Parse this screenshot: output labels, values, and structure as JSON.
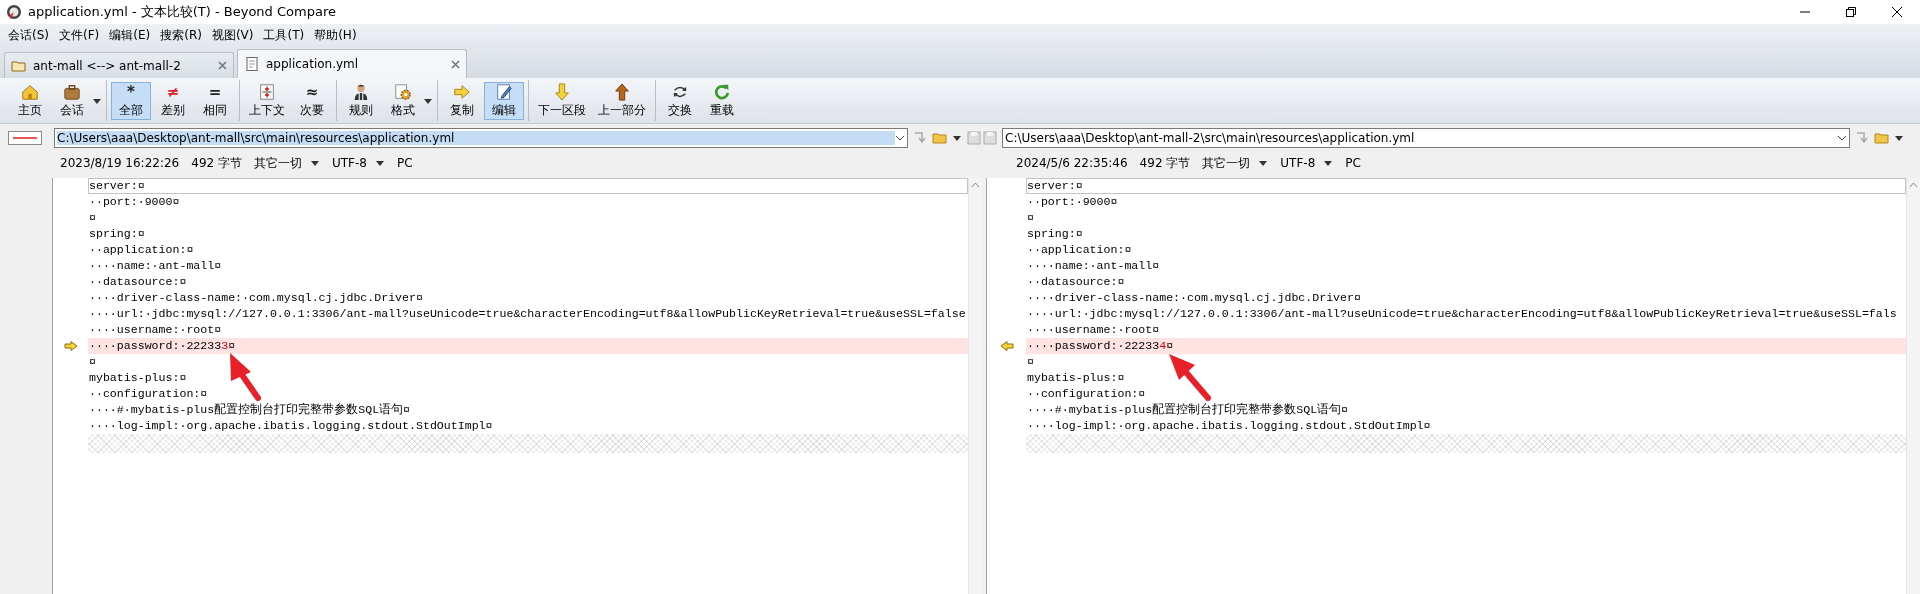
{
  "window": {
    "title": "application.yml - 文本比较(T) - Beyond Compare"
  },
  "menu": [
    "会话(S)",
    "文件(F)",
    "编辑(E)",
    "搜索(R)",
    "视图(V)",
    "工具(T)",
    "帮助(H)"
  ],
  "tabs": [
    {
      "label": "ant-mall <--> ant-mall-2",
      "selected": false
    },
    {
      "label": "application.yml",
      "selected": true
    }
  ],
  "toolbar": {
    "groups": [
      [
        {
          "label": "主页",
          "dropdown": false,
          "selected": false
        },
        {
          "label": "会话",
          "dropdown": true,
          "selected": false
        }
      ],
      [
        {
          "label": "全部",
          "glyph": "*",
          "color": "#202020",
          "dropdown": false,
          "selected": true
        },
        {
          "label": "差别",
          "glyph": "≠",
          "color": "#e02020",
          "dropdown": false,
          "selected": false
        },
        {
          "label": "相同",
          "glyph": "=",
          "color": "#202020",
          "dropdown": false,
          "selected": false
        }
      ],
      [
        {
          "label": "上下文",
          "dropdown": false,
          "selected": false
        },
        {
          "label": "次要",
          "glyph": "≈",
          "color": "#202020",
          "dropdown": false,
          "selected": false
        }
      ],
      [
        {
          "label": "规则",
          "dropdown": false,
          "selected": false
        },
        {
          "label": "格式",
          "dropdown": true,
          "selected": false
        }
      ],
      [
        {
          "label": "复制",
          "dropdown": false,
          "selected": false
        },
        {
          "label": "编辑",
          "dropdown": false,
          "selected": true
        }
      ],
      [
        {
          "label": "下一区段",
          "dropdown": false,
          "selected": false
        },
        {
          "label": "上一部分",
          "dropdown": false,
          "selected": false
        }
      ],
      [
        {
          "label": "交换",
          "dropdown": false,
          "selected": false
        },
        {
          "label": "重载",
          "dropdown": false,
          "selected": false
        }
      ]
    ]
  },
  "panes": [
    {
      "path": "C:\\Users\\aaa\\Desktop\\ant-mall\\src\\main\\resources\\application.yml",
      "focused": true,
      "date": "2023/8/19 16:22:26",
      "size": "492 字节",
      "filter": "其它一切",
      "encoding": "UTF-8",
      "line_ending": "PC",
      "lines": [
        {
          "text": "server:¤",
          "changed": false,
          "current": true
        },
        {
          "text": "··port:·9000¤",
          "changed": false,
          "current": false
        },
        {
          "text": "¤",
          "changed": false,
          "current": false
        },
        {
          "text": "spring:¤",
          "changed": false,
          "current": false
        },
        {
          "text": "··application:¤",
          "changed": false,
          "current": false
        },
        {
          "text": "····name:·ant-mall¤",
          "changed": false,
          "current": false
        },
        {
          "text": "··datasource:¤",
          "changed": false,
          "current": false
        },
        {
          "text": "····driver-class-name:·com.mysql.cj.jdbc.Driver¤",
          "changed": false,
          "current": false
        },
        {
          "text": "····url:·jdbc:mysql://127.0.0.1:3306/ant-mall?useUnicode=true&characterEncoding=utf8&allowPublicKeyRetrieval=true&useSSL=false",
          "changed": false,
          "current": false
        },
        {
          "text": "····username:·root¤",
          "changed": false,
          "current": false
        },
        {
          "text": "····password:·22233",
          "diff": "3",
          "tail": "¤",
          "changed": true,
          "current": false
        },
        {
          "text": "¤",
          "changed": false,
          "current": false
        },
        {
          "text": "mybatis-plus:¤",
          "changed": false,
          "current": false
        },
        {
          "text": "··configuration:¤",
          "changed": false,
          "current": false
        },
        {
          "text": "····#·mybatis-plus配置控制台打印完整带参数SQL语句¤",
          "changed": false,
          "current": false
        },
        {
          "text": "····log-impl:·org.apache.ibatis.logging.stdout.StdOutImpl¤",
          "changed": false,
          "current": false
        }
      ]
    },
    {
      "path": "C:\\Users\\aaa\\Desktop\\ant-mall-2\\src\\main\\resources\\application.yml",
      "focused": false,
      "date": "2024/5/6 22:35:46",
      "size": "492 字节",
      "filter": "其它一切",
      "encoding": "UTF-8",
      "line_ending": "PC",
      "lines": [
        {
          "text": "server:¤",
          "changed": false,
          "current": true
        },
        {
          "text": "··port:·9000¤",
          "changed": false,
          "current": false
        },
        {
          "text": "¤",
          "changed": false,
          "current": false
        },
        {
          "text": "spring:¤",
          "changed": false,
          "current": false
        },
        {
          "text": "··application:¤",
          "changed": false,
          "current": false
        },
        {
          "text": "····name:·ant-mall¤",
          "changed": false,
          "current": false
        },
        {
          "text": "··datasource:¤",
          "changed": false,
          "current": false
        },
        {
          "text": "····driver-class-name:·com.mysql.cj.jdbc.Driver¤",
          "changed": false,
          "current": false
        },
        {
          "text": "····url:·jdbc:mysql://127.0.0.1:3306/ant-mall?useUnicode=true&characterEncoding=utf8&allowPublicKeyRetrieval=true&useSSL=fals",
          "changed": false,
          "current": false
        },
        {
          "text": "····username:·root¤",
          "changed": false,
          "current": false
        },
        {
          "text": "····password:·22233",
          "diff": "4",
          "tail": "¤",
          "changed": true,
          "current": false
        },
        {
          "text": "¤",
          "changed": false,
          "current": false
        },
        {
          "text": "mybatis-plus:¤",
          "changed": false,
          "current": false
        },
        {
          "text": "··configuration:¤",
          "changed": false,
          "current": false
        },
        {
          "text": "····#·mybatis-plus配置控制台打印完整带参数SQL语句¤",
          "changed": false,
          "current": false
        },
        {
          "text": "····log-impl:·org.apache.ibatis.logging.stdout.StdOutImpl¤",
          "changed": false,
          "current": false
        }
      ]
    }
  ]
}
